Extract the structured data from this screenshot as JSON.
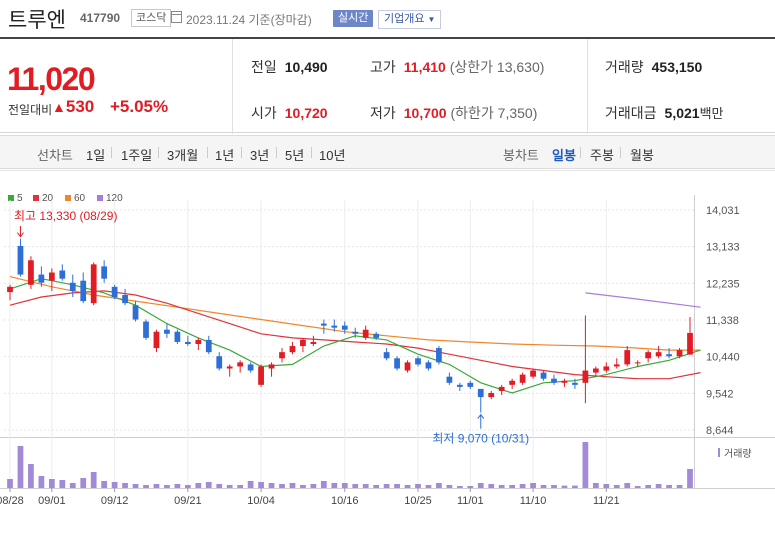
{
  "header": {
    "name": "트루엔",
    "code": "417790",
    "market": "코스닥",
    "date": "2023.11.24",
    "date_suffix": "기준(장마감)",
    "realtime_btn": "실시간",
    "company_btn": "기업개요"
  },
  "quote": {
    "price": "11,020",
    "change_label": "전일대비",
    "change": "530",
    "change_pct": "+5.05%",
    "prev_close_label": "전일",
    "prev_close": "10,490",
    "open_label": "시가",
    "open": "10,720",
    "high_label": "고가",
    "high": "11,410",
    "upper_limit": "(상한가 13,630)",
    "low_label": "저가",
    "low": "10,700",
    "lower_limit": "(하한가 7,350)",
    "volume_label": "거래량",
    "volume": "453,150",
    "amount_label": "거래대금",
    "amount": "5,021",
    "amount_unit": "백만"
  },
  "tabs": {
    "line_label": "선차트",
    "line": [
      "1일",
      "1주일",
      "3개월",
      "1년",
      "3년",
      "5년",
      "10년"
    ],
    "candle_label": "봉차트",
    "candle": [
      "일봉",
      "주봉",
      "월봉"
    ],
    "selected": "일봉"
  },
  "colors": {
    "up": "#e01c24",
    "down": "#2e6fd6",
    "ma5": "#3aa83a",
    "ma20": "#e0343c",
    "ma60": "#f0862b",
    "ma120": "#a77ddc"
  },
  "chart_data": {
    "type": "candlestick",
    "legend": [
      "5",
      "20",
      "60",
      "120"
    ],
    "y_ticks": [
      14031,
      13133,
      12235,
      11338,
      10440,
      9542,
      8644
    ],
    "ylim": [
      8644,
      14031
    ],
    "x_labels": [
      "08/28",
      "09/01",
      "09/12",
      "09/21",
      "10/04",
      "10/16",
      "10/25",
      "11/01",
      "11/10",
      "11/21"
    ],
    "x_label_days": [
      0,
      4,
      10,
      17,
      24,
      32,
      39,
      44,
      50,
      57
    ],
    "max_annotation": "최고 13,330 (08/29)",
    "min_annotation": "최저 9,070 (10/31)",
    "volume_label": "거래량",
    "candles": [
      [
        12020,
        12200,
        11820,
        12150,
        45
      ],
      [
        13150,
        13330,
        12400,
        12450,
        210
      ],
      [
        12200,
        12900,
        12100,
        12800,
        120
      ],
      [
        12450,
        12650,
        12150,
        12250,
        60
      ],
      [
        12300,
        12600,
        12050,
        12500,
        45
      ],
      [
        12550,
        12700,
        12300,
        12350,
        40
      ],
      [
        12250,
        12450,
        11900,
        12050,
        25
      ],
      [
        12300,
        12500,
        11750,
        11800,
        50
      ],
      [
        11750,
        12750,
        11700,
        12700,
        80
      ],
      [
        12650,
        12800,
        12250,
        12350,
        35
      ],
      [
        12150,
        12200,
        11850,
        11900,
        30
      ],
      [
        11950,
        12100,
        11700,
        11750,
        25
      ],
      [
        11700,
        11800,
        11300,
        11350,
        20
      ],
      [
        11300,
        11350,
        10850,
        10900,
        15
      ],
      [
        10650,
        11100,
        10550,
        11050,
        20
      ],
      [
        11100,
        11250,
        10900,
        11000,
        15
      ],
      [
        11050,
        11100,
        10750,
        10800,
        20
      ],
      [
        10800,
        10950,
        10700,
        10750,
        15
      ],
      [
        10750,
        10900,
        10600,
        10850,
        25
      ],
      [
        10850,
        10950,
        10500,
        10550,
        30
      ],
      [
        10450,
        10550,
        10100,
        10150,
        20
      ],
      [
        10150,
        10250,
        9950,
        10200,
        15
      ],
      [
        10200,
        10350,
        10050,
        10300,
        15
      ],
      [
        10250,
        10300,
        10050,
        10100,
        35
      ],
      [
        9750,
        10250,
        9700,
        10200,
        30
      ],
      [
        10150,
        10300,
        9950,
        10250,
        25
      ],
      [
        10400,
        10650,
        10300,
        10550,
        20
      ],
      [
        10550,
        10800,
        10500,
        10700,
        25
      ],
      [
        10700,
        10900,
        10550,
        10850,
        15
      ],
      [
        10750,
        10950,
        10700,
        10800,
        20
      ],
      [
        11250,
        11350,
        11000,
        11200,
        35
      ],
      [
        11200,
        11350,
        11050,
        11150,
        25
      ],
      [
        11200,
        11300,
        11000,
        11100,
        25
      ],
      [
        11050,
        11150,
        10900,
        11000,
        20
      ],
      [
        10900,
        11200,
        10850,
        11100,
        20
      ],
      [
        11000,
        11050,
        10850,
        10900,
        15
      ],
      [
        10550,
        10650,
        10350,
        10400,
        20
      ],
      [
        10400,
        10450,
        10100,
        10150,
        20
      ],
      [
        10100,
        10350,
        10050,
        10300,
        15
      ],
      [
        10400,
        10450,
        10200,
        10250,
        20
      ],
      [
        10300,
        10350,
        10100,
        10150,
        15
      ],
      [
        10650,
        10700,
        10250,
        10300,
        25
      ],
      [
        9950,
        10050,
        9750,
        9800,
        15
      ],
      [
        9750,
        9800,
        9600,
        9700,
        10
      ],
      [
        9800,
        9850,
        9650,
        9700,
        10
      ],
      [
        9650,
        9650,
        9070,
        9450,
        25
      ],
      [
        9450,
        9600,
        9400,
        9550,
        20
      ],
      [
        9600,
        9750,
        9500,
        9700,
        15
      ],
      [
        9750,
        9900,
        9650,
        9850,
        15
      ],
      [
        9800,
        10050,
        9750,
        10000,
        20
      ],
      [
        9950,
        10150,
        9900,
        10100,
        25
      ],
      [
        10050,
        10100,
        9850,
        9900,
        15
      ],
      [
        9900,
        10000,
        9750,
        9800,
        15
      ],
      [
        9800,
        9900,
        9700,
        9850,
        12
      ],
      [
        9800,
        9900,
        9650,
        9750,
        12
      ],
      [
        9800,
        11450,
        9300,
        10100,
        230
      ],
      [
        10050,
        10200,
        9950,
        10150,
        25
      ],
      [
        10100,
        10300,
        10050,
        10200,
        20
      ],
      [
        10200,
        10400,
        10150,
        10250,
        15
      ],
      [
        10250,
        10700,
        10200,
        10600,
        25
      ],
      [
        10300,
        10350,
        10200,
        10300,
        10
      ],
      [
        10400,
        10600,
        10300,
        10550,
        15
      ],
      [
        10450,
        10700,
        10400,
        10550,
        20
      ],
      [
        10500,
        10650,
        10400,
        10450,
        15
      ],
      [
        10450,
        10650,
        10400,
        10600,
        15
      ],
      [
        10490,
        11410,
        10490,
        11020,
        95
      ]
    ],
    "ma5": [
      [
        0,
        12100
      ],
      [
        3,
        12350
      ],
      [
        6,
        12200
      ],
      [
        9,
        12000
      ],
      [
        12,
        11700
      ],
      [
        15,
        11250
      ],
      [
        18,
        10900
      ],
      [
        21,
        10600
      ],
      [
        24,
        10200
      ],
      [
        27,
        10250
      ],
      [
        30,
        10700
      ],
      [
        33,
        10950
      ],
      [
        36,
        10850
      ],
      [
        39,
        10500
      ],
      [
        42,
        10250
      ],
      [
        45,
        9800
      ],
      [
        48,
        9550
      ],
      [
        51,
        9800
      ],
      [
        54,
        9850
      ],
      [
        57,
        10000
      ],
      [
        60,
        10200
      ],
      [
        63,
        10350
      ],
      [
        66,
        10600
      ]
    ],
    "ma20": [
      [
        0,
        11700
      ],
      [
        3,
        11900
      ],
      [
        6,
        12000
      ],
      [
        9,
        12050
      ],
      [
        12,
        11950
      ],
      [
        15,
        11750
      ],
      [
        18,
        11500
      ],
      [
        21,
        11250
      ],
      [
        24,
        11000
      ],
      [
        27,
        10900
      ],
      [
        30,
        10850
      ],
      [
        33,
        10800
      ],
      [
        36,
        10750
      ],
      [
        39,
        10650
      ],
      [
        42,
        10500
      ],
      [
        45,
        10350
      ],
      [
        48,
        10200
      ],
      [
        51,
        10100
      ],
      [
        54,
        10000
      ],
      [
        57,
        9950
      ],
      [
        60,
        9900
      ],
      [
        63,
        9900
      ],
      [
        66,
        10050
      ]
    ],
    "ma60": [
      [
        0,
        12400
      ],
      [
        4,
        12150
      ],
      [
        8,
        11950
      ],
      [
        12,
        11800
      ],
      [
        16,
        11650
      ],
      [
        20,
        11500
      ],
      [
        24,
        11350
      ],
      [
        28,
        11200
      ],
      [
        32,
        11050
      ],
      [
        36,
        10950
      ],
      [
        40,
        10850
      ],
      [
        44,
        10800
      ],
      [
        48,
        10750
      ],
      [
        52,
        10720
      ],
      [
        56,
        10700
      ],
      [
        60,
        10650
      ],
      [
        63,
        10600
      ],
      [
        66,
        10600
      ]
    ],
    "ma120": [
      [
        55,
        12000
      ],
      [
        60,
        11850
      ],
      [
        66,
        11650
      ]
    ]
  }
}
